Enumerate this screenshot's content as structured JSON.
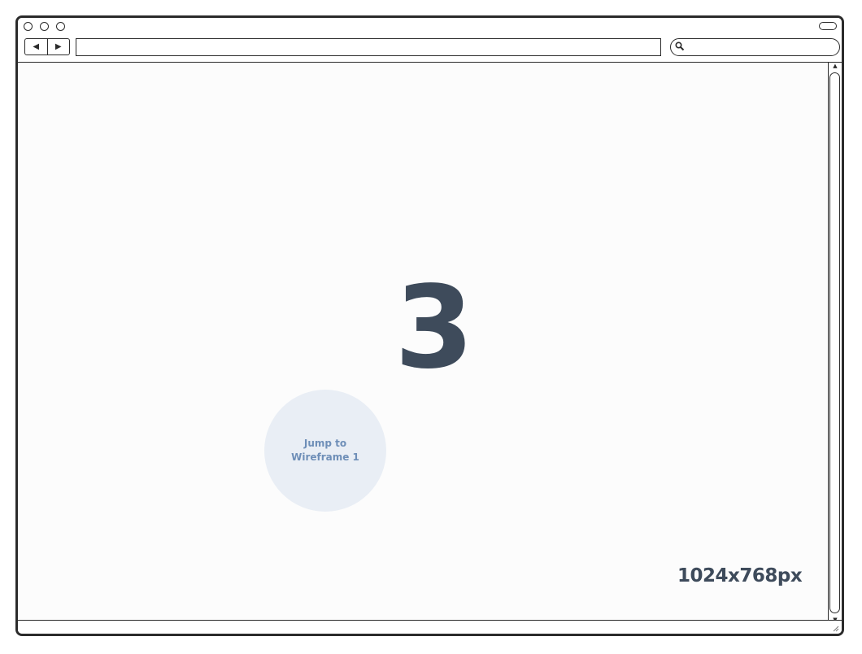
{
  "browser": {
    "back_icon": "◀",
    "forward_icon": "▶",
    "url_value": "",
    "search_value": ""
  },
  "main": {
    "big_number": "3",
    "jump_button_line1": "Jump to",
    "jump_button_line2": "Wireframe 1",
    "size_label": "1024x768px"
  },
  "scrollbar": {
    "up_icon": "▲",
    "down_icon": "▼"
  },
  "colors": {
    "accent_text": "#3e4b5b",
    "jump_bg": "#e9eef5",
    "jump_text": "#6f8fb8"
  }
}
